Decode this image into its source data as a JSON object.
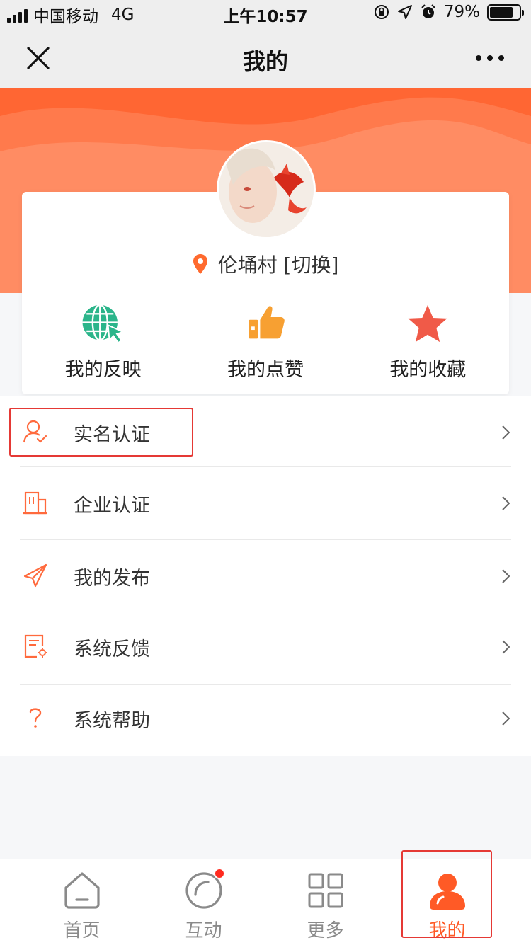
{
  "status_bar": {
    "carrier": "中国移动",
    "network": "4G",
    "time": "上午10:57",
    "battery_percent": "79%",
    "battery_level": 0.79
  },
  "nav": {
    "title": "我的",
    "close_icon": "close-icon",
    "more_icon": "more-dots-icon"
  },
  "profile": {
    "location": "伦埇村 [切换]",
    "location_icon": "location-pin-icon"
  },
  "quick_actions": [
    {
      "label": "我的反映",
      "icon": "globe-cursor-icon",
      "color": "#2bb58a"
    },
    {
      "label": "我的点赞",
      "icon": "thumbs-up-icon",
      "color": "#f7a032"
    },
    {
      "label": "我的收藏",
      "icon": "star-icon",
      "color": "#f05a48"
    }
  ],
  "menu": [
    {
      "label": "实名认证",
      "icon": "user-verify-icon"
    },
    {
      "label": "企业认证",
      "icon": "building-icon"
    },
    {
      "label": "我的发布",
      "icon": "send-icon"
    },
    {
      "label": "系统反馈",
      "icon": "feedback-settings-icon"
    },
    {
      "label": "系统帮助",
      "icon": "question-icon"
    }
  ],
  "tabs": [
    {
      "label": "首页",
      "icon": "home-icon",
      "active": false
    },
    {
      "label": "互动",
      "icon": "interact-circle-icon",
      "active": false,
      "badge": true
    },
    {
      "label": "更多",
      "icon": "grid-icon",
      "active": false
    },
    {
      "label": "我的",
      "icon": "person-icon",
      "active": true
    }
  ],
  "colors": {
    "accent": "#ff5a26",
    "banner": "#ff6633",
    "highlight": "#e53935",
    "tab_inactive": "#8a8a8a"
  }
}
